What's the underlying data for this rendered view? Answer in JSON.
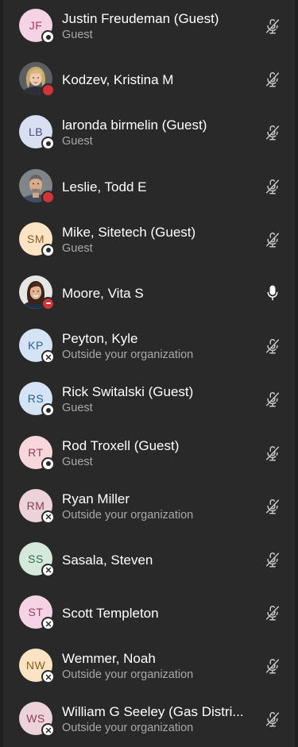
{
  "participants": [
    {
      "name": "Justin Freudeman (Guest)",
      "role": "Guest",
      "initials": "JF",
      "avatar_bg": "#f5d3e4",
      "avatar_fg": "#a4375f",
      "status": "offline",
      "mic": "muted"
    },
    {
      "name": "Kodzev, Kristina M",
      "role": "",
      "initials": "",
      "photo": "blonde",
      "status": "busy",
      "mic": "muted"
    },
    {
      "name": "laronda birmelin (Guest)",
      "role": "Guest",
      "initials": "LB",
      "avatar_bg": "#d9def1",
      "avatar_fg": "#464e8a",
      "status": "offline",
      "mic": "muted"
    },
    {
      "name": "Leslie, Todd E",
      "role": "",
      "initials": "",
      "photo": "man",
      "status": "busy",
      "mic": "muted"
    },
    {
      "name": "Mike, Sitetech (Guest)",
      "role": "Guest",
      "initials": "SM",
      "avatar_bg": "#fbe3c4",
      "avatar_fg": "#8e5a1a",
      "status": "offline",
      "mic": "muted"
    },
    {
      "name": "Moore, Vita S",
      "role": "",
      "initials": "",
      "photo": "brunette",
      "status": "dnd",
      "mic": "on"
    },
    {
      "name": "Peyton, Kyle",
      "role": "Outside your organization",
      "initials": "KP",
      "avatar_bg": "#d4e3f5",
      "avatar_fg": "#2a5d97",
      "status": "external",
      "mic": "muted"
    },
    {
      "name": "Rick Switalski (Guest)",
      "role": "Guest",
      "initials": "RS",
      "avatar_bg": "#d4e3f5",
      "avatar_fg": "#2a5d97",
      "status": "offline",
      "mic": "muted"
    },
    {
      "name": "Rod Troxell (Guest)",
      "role": "Guest",
      "initials": "RT",
      "avatar_bg": "#f7d7dc",
      "avatar_fg": "#a3384c",
      "status": "offline",
      "mic": "muted"
    },
    {
      "name": "Ryan Miller",
      "role": "Outside your organization",
      "initials": "RM",
      "avatar_bg": "#ecd3d9",
      "avatar_fg": "#8a3c52",
      "status": "external",
      "mic": "muted"
    },
    {
      "name": "Sasala, Steven",
      "role": "",
      "initials": "SS",
      "avatar_bg": "#d5e8dc",
      "avatar_fg": "#2f6a47",
      "status": "external",
      "mic": "muted"
    },
    {
      "name": "Scott Templeton",
      "role": "",
      "initials": "ST",
      "avatar_bg": "#f5d3e4",
      "avatar_fg": "#a4375f",
      "status": "external",
      "mic": "muted"
    },
    {
      "name": "Wemmer, Noah",
      "role": "Outside your organization",
      "initials": "NW",
      "avatar_bg": "#fbe3c4",
      "avatar_fg": "#8e5a1a",
      "status": "external",
      "mic": "muted"
    },
    {
      "name": "William G Seeley (Gas Distri...",
      "role": "Outside your organization",
      "initials": "WS",
      "avatar_bg": "#ecd3d9",
      "avatar_fg": "#8a3c52",
      "status": "external",
      "mic": "muted"
    }
  ],
  "colors": {
    "background": "#292929",
    "name_text": "#ffffff",
    "role_text": "#a8a8a8",
    "mic_icon": "#c8c8c8",
    "busy": "#d13438"
  },
  "icons": {
    "mic_muted": "microphone-off-icon",
    "mic_on": "microphone-icon",
    "external": "external-x-icon"
  }
}
